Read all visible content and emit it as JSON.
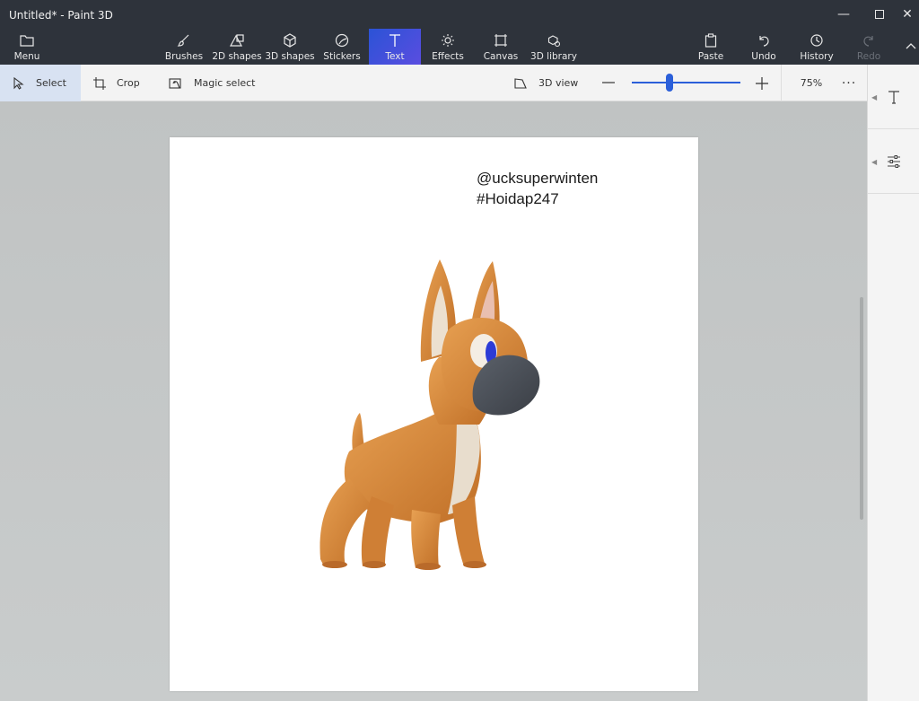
{
  "window": {
    "title": "Untitled* - Paint 3D"
  },
  "ribbon": {
    "menu_label": "Menu",
    "tools": [
      {
        "label": "Brushes",
        "icon": "brush-icon"
      },
      {
        "label": "2D shapes",
        "icon": "shapes-2d-icon"
      },
      {
        "label": "3D shapes",
        "icon": "cube-icon"
      },
      {
        "label": "Stickers",
        "icon": "sticker-icon"
      },
      {
        "label": "Text",
        "icon": "text-icon",
        "active": true
      },
      {
        "label": "Effects",
        "icon": "sun-icon"
      },
      {
        "label": "Canvas",
        "icon": "canvas-icon"
      },
      {
        "label": "3D library",
        "icon": "library-icon"
      }
    ],
    "paste_label": "Paste",
    "undo_label": "Undo",
    "history_label": "History",
    "redo_label": "Redo"
  },
  "subbar": {
    "select_label": "Select",
    "crop_label": "Crop",
    "magic_select_label": "Magic select",
    "view3d_label": "3D view",
    "zoom_value": "75%",
    "zoom_slider_fraction": 0.35,
    "more_label": "···"
  },
  "canvas": {
    "text_line1": "@ucksuperwinten",
    "text_line2": "#Hoidap247"
  },
  "colors": {
    "ribbon_bg": "#2e333b",
    "accent": "#2b5fd9",
    "dog_body": "#d98a3a",
    "dog_muzzle": "#4a4f57"
  }
}
